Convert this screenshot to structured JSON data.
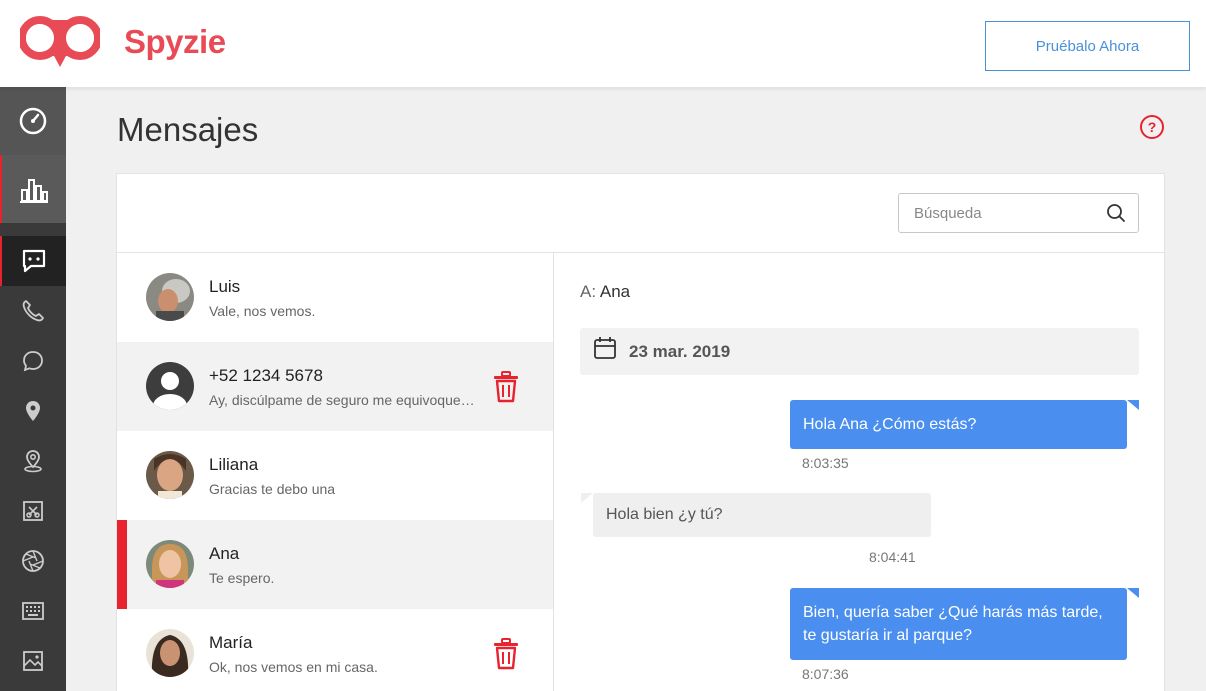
{
  "header": {
    "brand": "Spyzie",
    "cta_label": "Pruébalo Ahora"
  },
  "sidebar": {
    "items": [
      {
        "icon": "dashboard-icon"
      },
      {
        "icon": "bar-chart-icon"
      },
      {
        "icon": "messages-icon",
        "active": true
      },
      {
        "icon": "phone-icon"
      },
      {
        "icon": "chat-bubble-icon"
      },
      {
        "icon": "location-pin-icon"
      },
      {
        "icon": "geofence-icon"
      },
      {
        "icon": "crop-icon"
      },
      {
        "icon": "camera-shutter-icon"
      },
      {
        "icon": "keyboard-icon"
      },
      {
        "icon": "image-icon"
      }
    ]
  },
  "main": {
    "title": "Mensajes",
    "search_placeholder": "Búsqueda"
  },
  "contacts": [
    {
      "name": "Luis",
      "preview": "Vale, nos vemos.",
      "avatar": "photo"
    },
    {
      "name": "+52 1234 5678",
      "preview": "Ay, discúlpame de seguro me equivoque…",
      "avatar": "default",
      "hover": true
    },
    {
      "name": "Liliana",
      "preview": "Gracias te debo una",
      "avatar": "photo"
    },
    {
      "name": "Ana",
      "preview": "Te espero.",
      "avatar": "photo",
      "active": true
    },
    {
      "name": "María",
      "preview": "Ok, nos vemos en mi casa.",
      "avatar": "photo"
    }
  ],
  "conversation": {
    "to_label": "A:",
    "to_name": "Ana",
    "date": "23 mar. 2019",
    "messages": [
      {
        "direction": "out",
        "text": "Hola Ana ¿Cómo estás?",
        "time": "8:03:35"
      },
      {
        "direction": "in",
        "text": "Hola bien ¿y tú?",
        "time": "8:04:41"
      },
      {
        "direction": "out",
        "text": "Bien, quería saber ¿Qué harás más tarde, te gustaría ir al parque?",
        "time": "8:07:36"
      }
    ]
  },
  "colors": {
    "brand_red": "#e94b56",
    "accent_blue": "#4a8ff0",
    "active_bar": "#e8222f",
    "trash_red": "#e8222f"
  }
}
